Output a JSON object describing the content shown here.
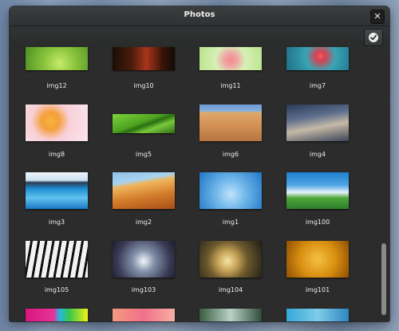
{
  "window": {
    "title": "Photos"
  },
  "titlebar": {
    "close_glyph": "✕"
  },
  "photos": [
    {
      "name": "img12"
    },
    {
      "name": "img10"
    },
    {
      "name": "img11"
    },
    {
      "name": "img7"
    },
    {
      "name": "img8"
    },
    {
      "name": "img5"
    },
    {
      "name": "img6"
    },
    {
      "name": "img4"
    },
    {
      "name": "img3"
    },
    {
      "name": "img2"
    },
    {
      "name": "img1"
    },
    {
      "name": "img100"
    },
    {
      "name": "img105"
    },
    {
      "name": "img103"
    },
    {
      "name": "img104"
    },
    {
      "name": "img101"
    }
  ],
  "icons": {
    "select": "check-circle-icon",
    "close": "close-icon"
  }
}
